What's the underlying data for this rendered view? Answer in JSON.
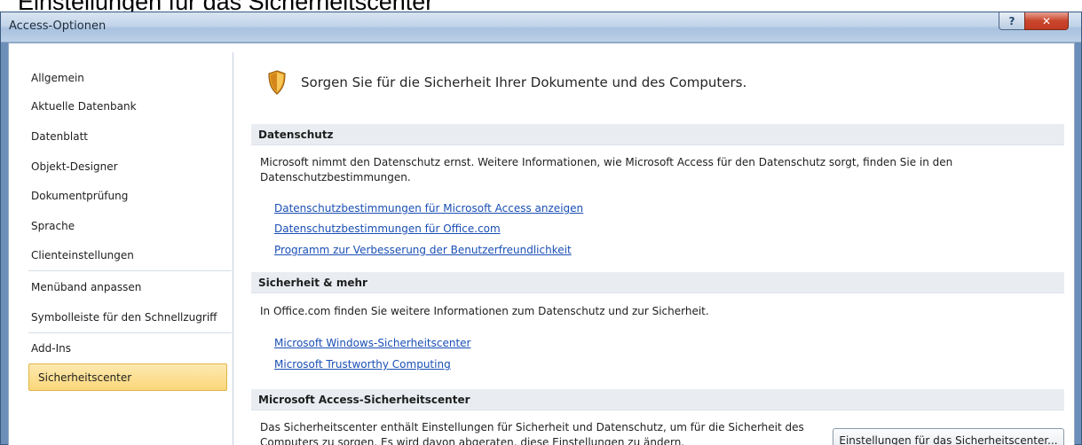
{
  "caption": "Einstellungen für das Sicherheitscenter",
  "window": {
    "title": "Access-Optionen",
    "help_label": "?",
    "close_label": "✕"
  },
  "nav": {
    "items": [
      {
        "label": "Allgemein"
      },
      {
        "label": "Aktuelle Datenbank"
      },
      {
        "label": "Datenblatt"
      },
      {
        "label": "Objekt-Designer"
      },
      {
        "label": "Dokumentprüfung"
      },
      {
        "label": "Sprache"
      },
      {
        "label": "Clienteinstellungen"
      },
      {
        "label": "Menüband anpassen"
      },
      {
        "label": "Symbolleiste für den Schnellzugriff"
      },
      {
        "label": "Add-Ins"
      },
      {
        "label": "Sicherheitscenter",
        "selected": true
      }
    ]
  },
  "header": {
    "icon": "shield-icon",
    "text": "Sorgen Sie für die Sicherheit Ihrer Dokumente und des Computers."
  },
  "privacy": {
    "title": "Datenschutz",
    "description_line1": "Microsoft nimmt den Datenschutz ernst. Weitere Informationen, wie Microsoft Access für den Datenschutz sorgt, finden Sie in den",
    "description_line2": "Datenschutzbestimmungen.",
    "links": [
      "Datenschutzbestimmungen für Microsoft Access anzeigen",
      "Datenschutzbestimmungen für Office.com",
      "Programm zur Verbesserung der Benutzerfreundlichkeit"
    ]
  },
  "security": {
    "title": "Sicherheit & mehr",
    "description": "In Office.com finden Sie weitere Informationen zum Datenschutz und zur Sicherheit.",
    "links": [
      "Microsoft Windows-Sicherheitscenter",
      "Microsoft Trustworthy Computing"
    ]
  },
  "trust_center": {
    "title": "Microsoft Access-Sicherheitscenter",
    "description_line1": "Das Sicherheitscenter enthält Einstellungen für Sicherheit und Datenschutz, um für die Sicherheit des",
    "description_line2": "Computers zu sorgen. Es wird davon abgeraten, diese Einstellungen zu ändern.",
    "button_label": "Einstellungen für das Sicherheitscenter..."
  },
  "colors": {
    "selected_bg": "#fbd779",
    "link": "#1a4fb4",
    "section_bg": "#e9edf2",
    "frame": "#6b8fb8"
  }
}
